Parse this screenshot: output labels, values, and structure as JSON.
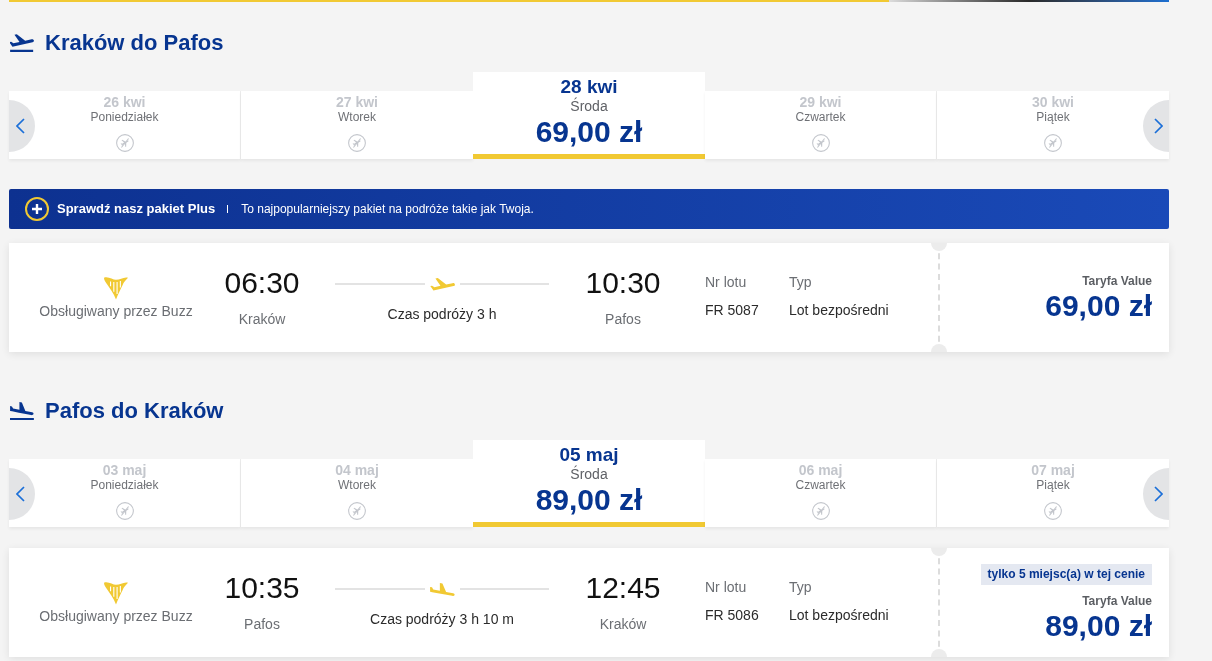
{
  "sections": [
    {
      "kind": "outbound",
      "title": "Kraków do Pafos",
      "dates": [
        {
          "date": "26 kwi",
          "weekday": "Poniedziałek",
          "no_flights": true,
          "selected": false
        },
        {
          "date": "27 kwi",
          "weekday": "Wtorek",
          "no_flights": true,
          "selected": false
        },
        {
          "date": "28 kwi",
          "weekday": "Środa",
          "price": "69,00 zł",
          "no_flights": false,
          "selected": true
        },
        {
          "date": "29 kwi",
          "weekday": "Czwartek",
          "no_flights": true,
          "selected": false
        },
        {
          "date": "30 kwi",
          "weekday": "Piątek",
          "no_flights": true,
          "selected": false
        }
      ],
      "promo": {
        "title": "Sprawdź nasz pakiet Plus",
        "text": "To najpopularniejszy pakiet na podróże takie jak Twoja."
      },
      "flight": {
        "operator": "Obsługiwany przez Buzz",
        "departure_time": "06:30",
        "departure_city": "Kraków",
        "duration": "Czas podróży 3 h",
        "arrival_time": "10:30",
        "arrival_city": "Pafos",
        "flight_number_label": "Nr lotu",
        "flight_number": "FR 5087",
        "type_label": "Typ",
        "type": "Lot bezpośredni",
        "fare": "Taryfa Value",
        "price": "69,00 zł"
      }
    },
    {
      "kind": "return",
      "title": "Pafos do Kraków",
      "dates": [
        {
          "date": "03 maj",
          "weekday": "Poniedziałek",
          "no_flights": true,
          "selected": false
        },
        {
          "date": "04 maj",
          "weekday": "Wtorek",
          "no_flights": true,
          "selected": false
        },
        {
          "date": "05 maj",
          "weekday": "Środa",
          "price": "89,00 zł",
          "no_flights": false,
          "selected": true
        },
        {
          "date": "06 maj",
          "weekday": "Czwartek",
          "no_flights": true,
          "selected": false
        },
        {
          "date": "07 maj",
          "weekday": "Piątek",
          "no_flights": true,
          "selected": false
        }
      ],
      "flight": {
        "operator": "Obsługiwany przez Buzz",
        "departure_time": "10:35",
        "departure_city": "Pafos",
        "duration": "Czas podróży 3 h 10 m",
        "arrival_time": "12:45",
        "arrival_city": "Kraków",
        "flight_number_label": "Nr lotu",
        "flight_number": "FR 5086",
        "type_label": "Typ",
        "type": "Lot bezpośredni",
        "notice": "tylko 5 miejsc(a) w tej cenie",
        "fare": "Taryfa Value",
        "price": "89,00 zł"
      }
    }
  ]
}
